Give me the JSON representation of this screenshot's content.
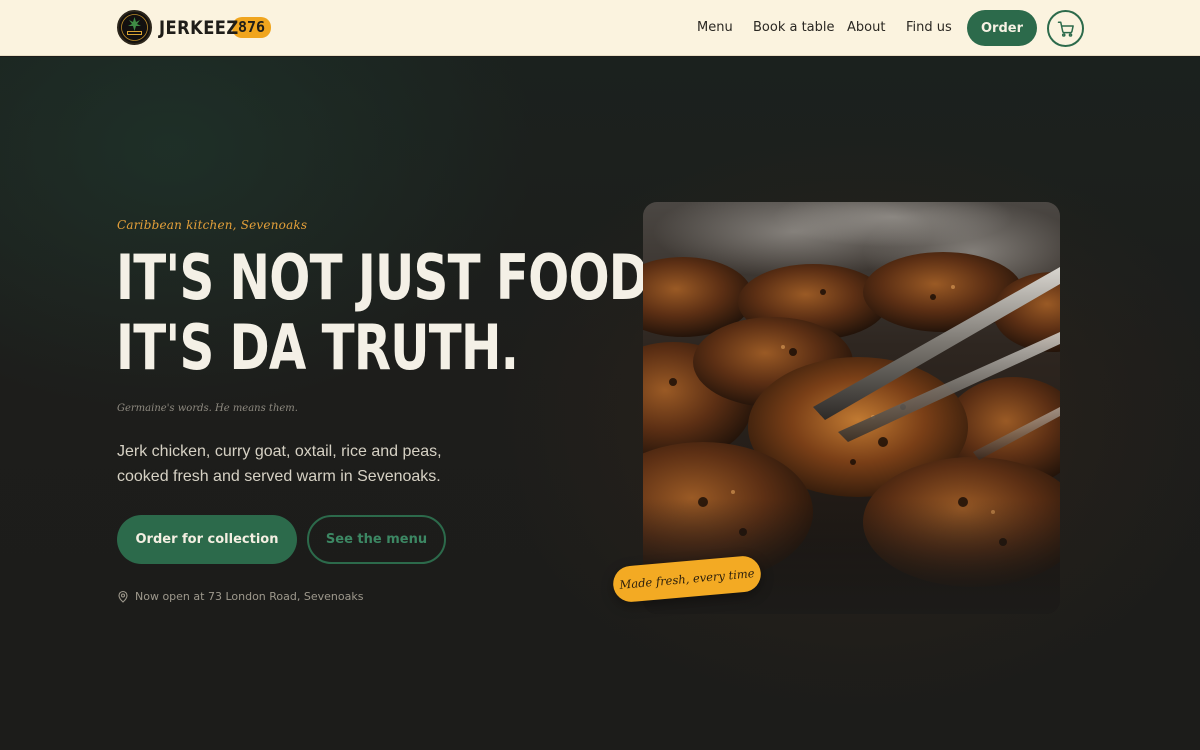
{
  "header": {
    "brand_name": "JERKEEZ",
    "brand_number": "876",
    "logo_icon": "jerkeez-logo-icon",
    "nav": [
      {
        "label": "Menu"
      },
      {
        "label": "Book a table"
      },
      {
        "label": "About"
      },
      {
        "label": "Find us"
      }
    ],
    "order_label": "Order",
    "cart_icon": "cart-icon"
  },
  "hero": {
    "eyebrow": "Caribbean kitchen, Sevenoaks",
    "headline_line1": "IT'S NOT JUST FOOD,",
    "headline_line2": "IT'S DA TRUTH.",
    "signature": "Germaine's words. He means them.",
    "lede": "Jerk chicken, curry goat, oxtail, rice and peas, cooked fresh and served warm in Sevenoaks.",
    "cta_primary": "Order for collection",
    "cta_secondary": "See the menu",
    "location_text": "Now open at 73 London Road, Sevenoaks",
    "sticker": "Made fresh, every time"
  },
  "colors": {
    "header_bg": "#fbf3df",
    "brand_green": "#2c6a4b",
    "accent_orange": "#f0a51e",
    "page_bg": "#1c1d1b",
    "headline": "#f4f0e6"
  }
}
